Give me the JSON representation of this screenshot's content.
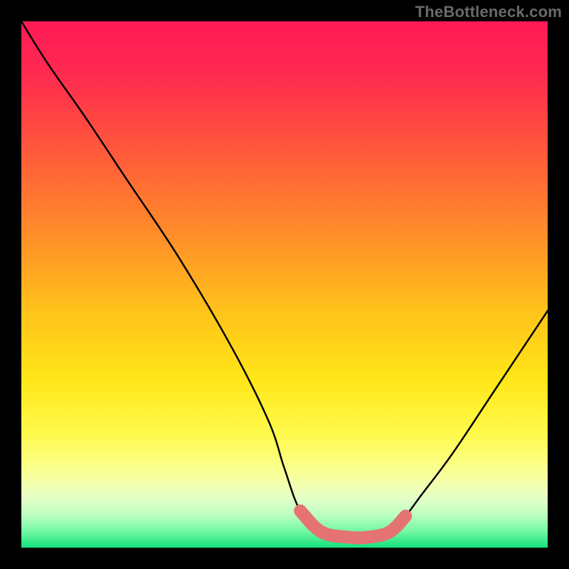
{
  "watermark": "TheBottleneck.com",
  "chart_data": {
    "type": "line",
    "title": "",
    "xlabel": "",
    "ylabel": "",
    "xlim": [
      0,
      100
    ],
    "ylim": [
      0,
      100
    ],
    "series": [
      {
        "name": "bottleneck-curve",
        "x": [
          0,
          5,
          12,
          20,
          30,
          40,
          47,
          50,
          53,
          57,
          62,
          66,
          70,
          73,
          76,
          82,
          90,
          100
        ],
        "values": [
          100,
          92,
          82,
          70,
          55,
          38,
          24,
          15,
          7,
          3,
          2,
          2,
          3,
          6,
          10,
          18,
          30,
          45
        ]
      }
    ],
    "highlight_segment": {
      "name": "optimal-range",
      "x": [
        53,
        57,
        62,
        66,
        70,
        73
      ],
      "values": [
        7,
        3,
        2,
        2,
        3,
        6
      ],
      "color": "#e57373"
    },
    "gradient_stops": [
      {
        "offset": 0.0,
        "color": "#ff1a55"
      },
      {
        "offset": 0.1,
        "color": "#ff2a50"
      },
      {
        "offset": 0.25,
        "color": "#ff5a3a"
      },
      {
        "offset": 0.4,
        "color": "#ff8c2a"
      },
      {
        "offset": 0.55,
        "color": "#ffc21a"
      },
      {
        "offset": 0.68,
        "color": "#ffe618"
      },
      {
        "offset": 0.78,
        "color": "#fff94a"
      },
      {
        "offset": 0.84,
        "color": "#fcff82"
      },
      {
        "offset": 0.88,
        "color": "#f3ffb0"
      },
      {
        "offset": 0.91,
        "color": "#e0ffc8"
      },
      {
        "offset": 0.94,
        "color": "#b8ffbe"
      },
      {
        "offset": 0.97,
        "color": "#70f7a0"
      },
      {
        "offset": 0.99,
        "color": "#30e889"
      },
      {
        "offset": 1.0,
        "color": "#18df7c"
      }
    ]
  }
}
